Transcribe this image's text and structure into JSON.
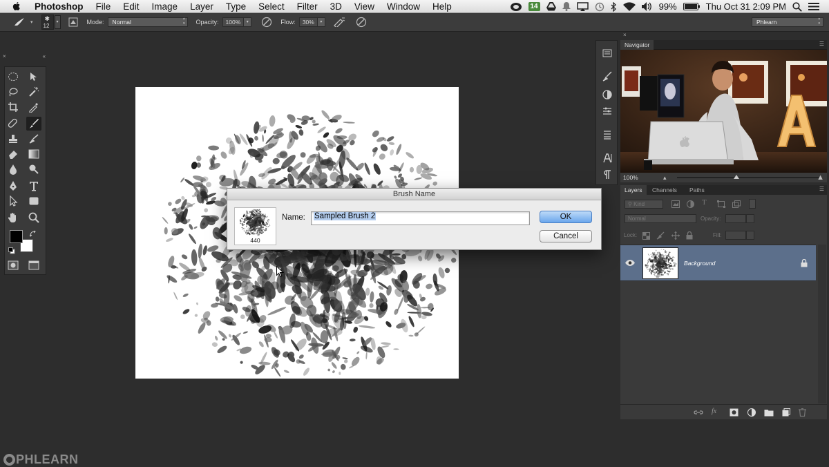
{
  "menubar": {
    "app_name": "Photoshop",
    "items": [
      "File",
      "Edit",
      "Image",
      "Layer",
      "Type",
      "Select",
      "Filter",
      "3D",
      "View",
      "Window",
      "Help"
    ],
    "badge": "14",
    "battery": "99%",
    "datetime": "Thu Oct 31  2:09 PM"
  },
  "options": {
    "brush_size": "12",
    "mode_label": "Mode:",
    "mode_value": "Normal",
    "opacity_label": "Opacity:",
    "opacity_value": "100%",
    "flow_label": "Flow:",
    "flow_value": "30%",
    "workspace": "Phlearn"
  },
  "dialog": {
    "title": "Brush Name",
    "name_label": "Name:",
    "name_value": "Sampled Brush 2",
    "brush_number": "440",
    "ok": "OK",
    "cancel": "Cancel"
  },
  "navigator": {
    "title": "Navigator",
    "zoom": "100%"
  },
  "layers": {
    "tabs": [
      "Layers",
      "Channels",
      "Paths"
    ],
    "kind": "Kind",
    "blend_mode": "Normal",
    "opacity_label": "Opacity:",
    "lock_label": "Lock:",
    "fill_label": "Fill:",
    "layer_name": "Background"
  },
  "watermark": "PHLEARN",
  "colors": {
    "accent_blue": "#6aa6ec",
    "layer_selected": "#5c6f8b",
    "panel": "#3a3a3a",
    "workspace_bg": "#2d2d2d"
  }
}
